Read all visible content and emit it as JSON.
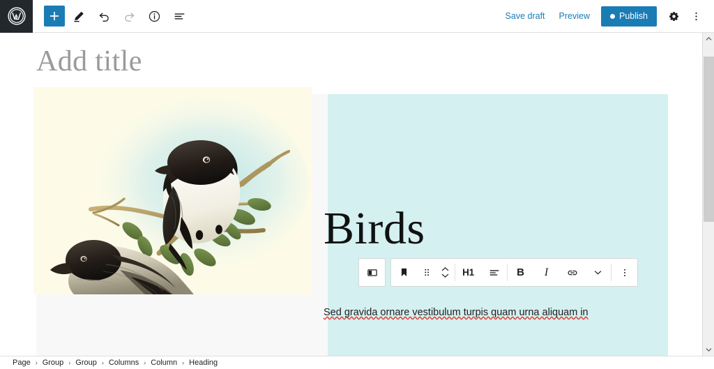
{
  "app": {
    "name": "WordPress Block Editor",
    "logo_icon": "wordpress-logo-icon"
  },
  "toolbar": {
    "add_block": {
      "label": "+",
      "icon": "plus-icon",
      "title": "Add block"
    },
    "tools": {
      "icon": "pencil-icon",
      "title": "Tools"
    },
    "undo": {
      "icon": "undo-arrow-icon",
      "title": "Undo"
    },
    "redo": {
      "icon": "redo-arrow-icon",
      "title": "Redo",
      "state": "disabled"
    },
    "details": {
      "icon": "info-circle-icon",
      "title": "Details"
    },
    "list_view": {
      "icon": "list-view-icon",
      "title": "List View"
    },
    "save_draft_label": "Save draft",
    "preview_label": "Preview",
    "publish_label": "Publish",
    "settings": {
      "icon": "gear-icon",
      "title": "Settings"
    },
    "options": {
      "icon": "three-dots-vertical-icon",
      "title": "Options"
    }
  },
  "colors": {
    "accent_blue": "#1a7cb5",
    "logo_bar": "#23282d",
    "column_left_bg": "#f8f8f9",
    "column_right_bg": "#d4f0f1",
    "image_bg": "#fdfbe8",
    "spellcheck_underline": "#e03b2f"
  },
  "editor": {
    "title_placeholder": "Add title",
    "title_value": "",
    "heading_text": "Birds",
    "paragraph_text": "Sed gravida ornare vestibulum turpis quam urna aliquam in",
    "image_alt": "Vintage illustration of two black and white birds perched on a branch with green leaves"
  },
  "block_toolbar": {
    "parent_block": {
      "icon": "columns-icon",
      "title": "Select Columns"
    },
    "block_type": {
      "icon": "heading-block-icon",
      "title": "Heading"
    },
    "drag": {
      "icon": "drag-handle-icon",
      "title": "Drag"
    },
    "move": {
      "icon": "move-up-down-icon",
      "title": "Move up or down"
    },
    "heading_level_label": "H1",
    "align": {
      "icon": "align-left-icon",
      "title": "Align text"
    },
    "bold_label": "B",
    "italic_label": "I",
    "link": {
      "icon": "link-icon",
      "title": "Link"
    },
    "more_formats": {
      "icon": "chevron-down-icon",
      "title": "More"
    },
    "options": {
      "icon": "three-dots-vertical-icon",
      "title": "Options"
    }
  },
  "scrollbar": {
    "up": {
      "icon": "chevron-up-icon"
    },
    "down": {
      "icon": "chevron-down-icon"
    },
    "thumb_position_percent": 7,
    "thumb_size_percent": 55
  },
  "breadcrumb": {
    "separator": "›",
    "items": [
      {
        "label": "Page"
      },
      {
        "label": "Group"
      },
      {
        "label": "Group"
      },
      {
        "label": "Columns"
      },
      {
        "label": "Column"
      },
      {
        "label": "Heading"
      }
    ]
  }
}
